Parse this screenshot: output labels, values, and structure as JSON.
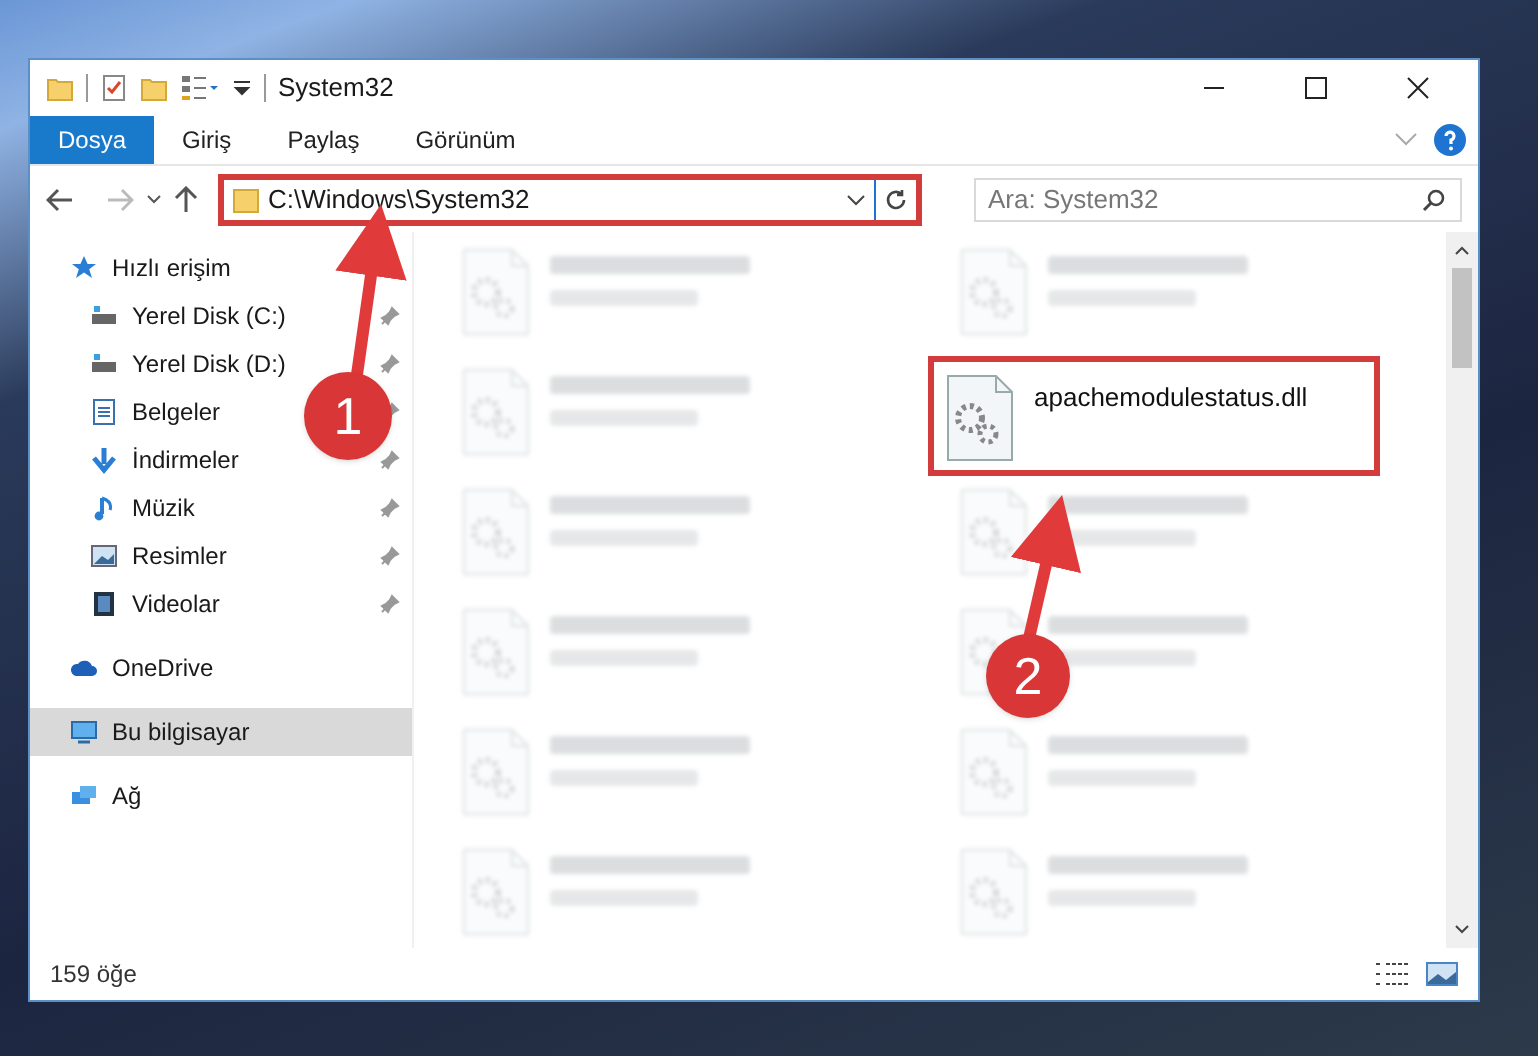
{
  "window": {
    "title": "System32"
  },
  "ribbon_tabs": [
    {
      "label": "Dosya",
      "selected": true
    },
    {
      "label": "Giriş",
      "selected": false
    },
    {
      "label": "Paylaş",
      "selected": false
    },
    {
      "label": "Görünüm",
      "selected": false
    }
  ],
  "address": {
    "path": "C:\\Windows\\System32"
  },
  "search": {
    "placeholder": "Ara: System32"
  },
  "sidebar": {
    "items": [
      {
        "label": "Hızlı erişim",
        "kind": "star",
        "pinned": false,
        "selected": false,
        "children": [
          {
            "label": "Yerel Disk (C:)",
            "kind": "disk",
            "pinned": true,
            "selected": false
          },
          {
            "label": "Yerel Disk (D:)",
            "kind": "disk",
            "pinned": true,
            "selected": false
          },
          {
            "label": "Belgeler",
            "kind": "doc",
            "pinned": true,
            "selected": false
          },
          {
            "label": "İndirmeler",
            "kind": "download",
            "pinned": true,
            "selected": false
          },
          {
            "label": "Müzik",
            "kind": "music",
            "pinned": true,
            "selected": false
          },
          {
            "label": "Resimler",
            "kind": "picture",
            "pinned": true,
            "selected": false
          },
          {
            "label": "Videolar",
            "kind": "video",
            "pinned": true,
            "selected": false
          }
        ]
      },
      {
        "label": "OneDrive",
        "kind": "cloud",
        "pinned": false,
        "selected": false
      },
      {
        "label": "Bu bilgisayar",
        "kind": "pc",
        "pinned": false,
        "selected": true
      },
      {
        "label": "Ağ",
        "kind": "network",
        "pinned": false,
        "selected": false
      }
    ]
  },
  "files": [
    {
      "blurred": true,
      "highlighted": false
    },
    {
      "blurred": true,
      "highlighted": false
    },
    {
      "blurred": true,
      "highlighted": false
    },
    {
      "name": "apachemodulestatus.dll",
      "blurred": false,
      "highlighted": true
    },
    {
      "blurred": true,
      "highlighted": false
    },
    {
      "blurred": true,
      "highlighted": false
    },
    {
      "blurred": true,
      "highlighted": false
    },
    {
      "blurred": true,
      "highlighted": false
    },
    {
      "blurred": true,
      "highlighted": false
    },
    {
      "blurred": true,
      "highlighted": false
    },
    {
      "blurred": true,
      "highlighted": false
    },
    {
      "blurred": true,
      "highlighted": false
    }
  ],
  "status_bar": {
    "count": "159 öğe"
  },
  "callouts": [
    {
      "number": "1"
    },
    {
      "number": "2"
    }
  ]
}
